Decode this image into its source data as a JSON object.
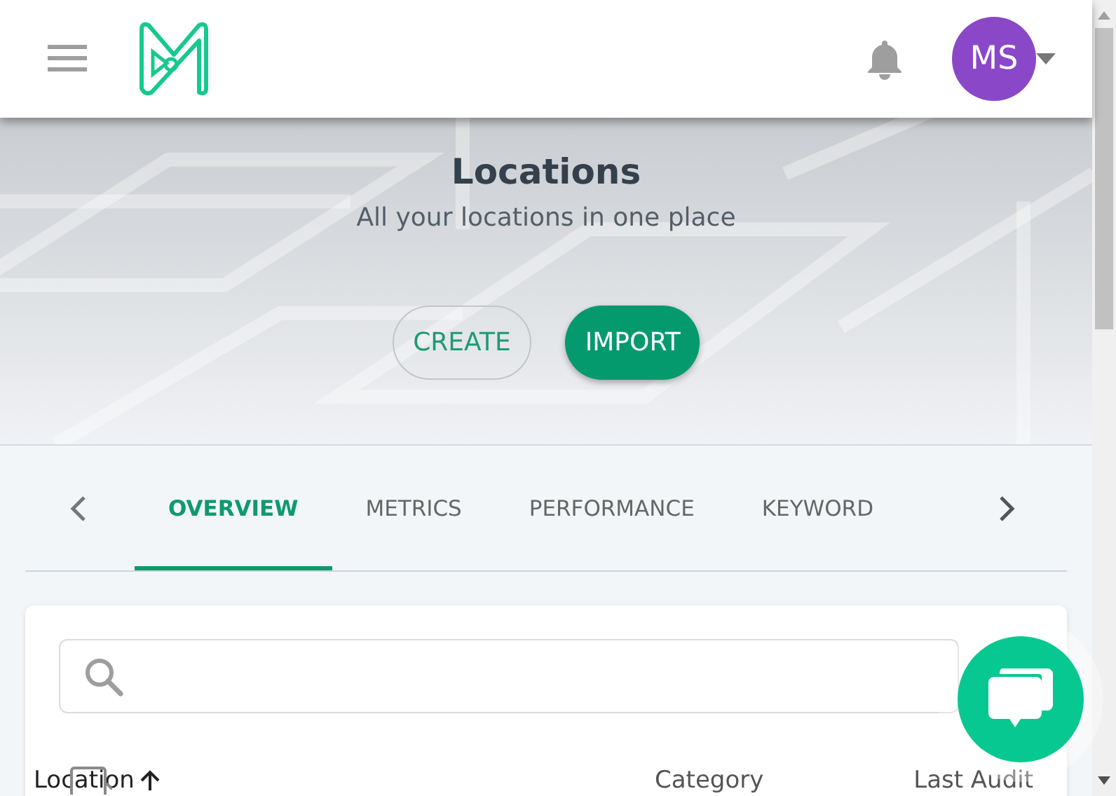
{
  "header": {
    "avatar": {
      "initials": "MS"
    }
  },
  "hero": {
    "title": "Locations",
    "subtitle": "All your locations in one place",
    "buttons": [
      {
        "label": "CREATE",
        "kind": "outline"
      },
      {
        "label": "IMPORT",
        "kind": "filled"
      }
    ]
  },
  "tabs": [
    {
      "label": "OVERVIEW",
      "selected": true
    },
    {
      "label": "METRICS",
      "selected": false
    },
    {
      "label": "PERFORMANCE",
      "selected": false
    },
    {
      "label": "KEYWORD",
      "selected": false
    }
  ],
  "table": {
    "select_all": {
      "checked": false
    },
    "columns": [
      {
        "label": "Location",
        "sorted": true
      },
      {
        "label": "Category",
        "sorted": false
      },
      {
        "label": "Last Audit",
        "sorted": false
      }
    ]
  }
}
